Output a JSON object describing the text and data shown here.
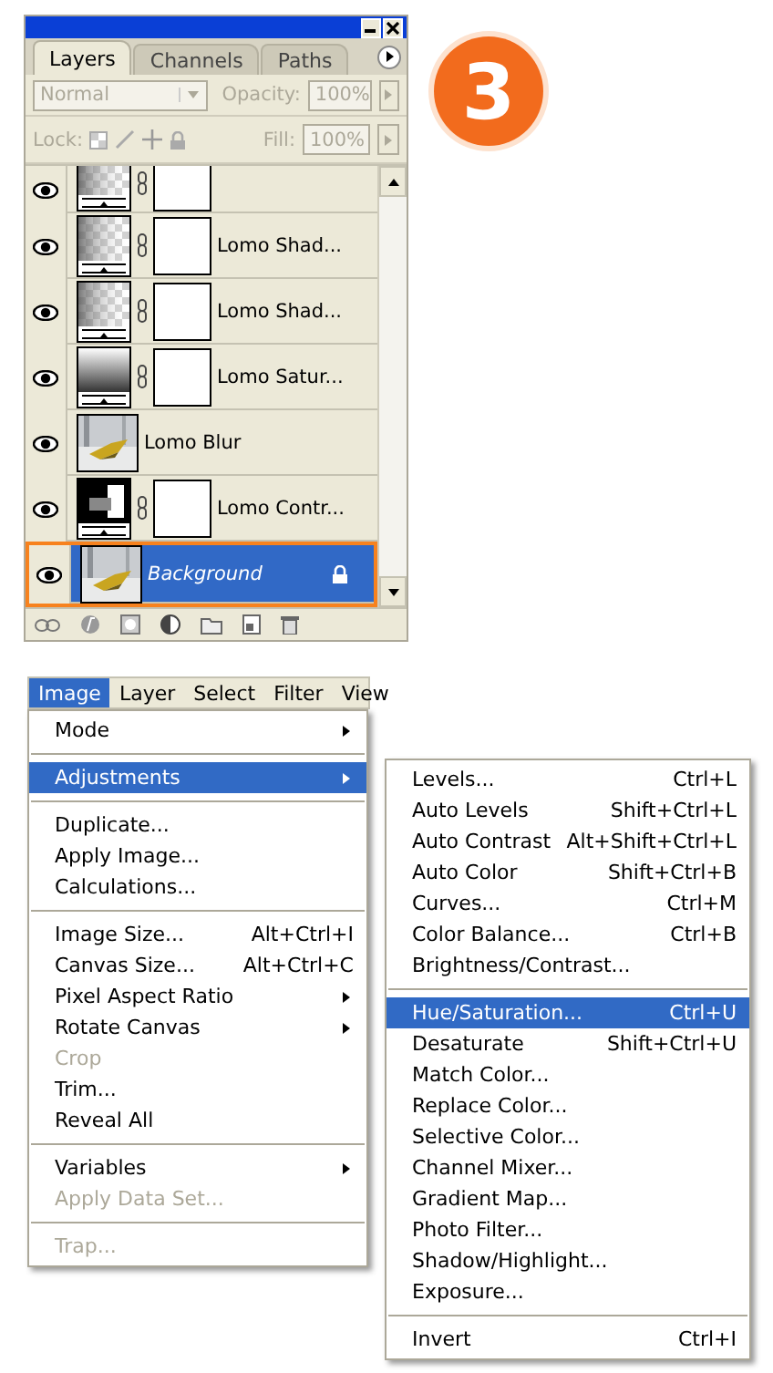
{
  "panel": {
    "tabs": [
      {
        "label": "Layers",
        "selected": true
      },
      {
        "label": "Channels",
        "selected": false
      },
      {
        "label": "Paths",
        "selected": false
      }
    ],
    "blend_mode": {
      "value": "Normal",
      "disabled": true
    },
    "opacity": {
      "label": "Opacity:",
      "value": "100%",
      "disabled": true
    },
    "lock_label": "Lock:",
    "fill": {
      "label": "Fill:",
      "value": "100%",
      "disabled": true
    },
    "layers": [
      {
        "cut": true,
        "kind": "checker",
        "mask": true,
        "visible": true,
        "selected": false,
        "locked": false
      },
      {
        "cut": false,
        "name": "Lomo Shad...",
        "kind": "checker",
        "mask": true,
        "visible": true,
        "selected": false,
        "locked": false
      },
      {
        "cut": false,
        "name": "Lomo Shad...",
        "kind": "checker",
        "mask": true,
        "visible": true,
        "selected": false,
        "locked": false
      },
      {
        "cut": false,
        "name": "Lomo Satur...",
        "kind": "gradient",
        "mask": true,
        "visible": true,
        "selected": false,
        "locked": false
      },
      {
        "cut": false,
        "name": "Lomo Blur",
        "mask": false,
        "visible": true,
        "selected": false,
        "locked": false
      },
      {
        "cut": false,
        "name": "Lomo Contr...",
        "kind": "contrast",
        "mask": true,
        "visible": true,
        "selected": false,
        "locked": false
      },
      {
        "cut": false,
        "name": "Background",
        "mask": false,
        "visible": true,
        "selected": true,
        "locked": true
      }
    ]
  },
  "step_badge": "3",
  "menubar": [
    {
      "label": "Image",
      "selected": true
    },
    {
      "label": "Layer",
      "selected": false
    },
    {
      "label": "Select",
      "selected": false
    },
    {
      "label": "Filter",
      "selected": false
    },
    {
      "label": "View",
      "selected": false
    }
  ],
  "menu": {
    "items": [
      {
        "kind": "item",
        "label": "Mode",
        "submenu": true,
        "disabled": false,
        "selected": false
      },
      {
        "kind": "separator"
      },
      {
        "kind": "item",
        "label": "Adjustments",
        "submenu": true,
        "disabled": false,
        "selected": true
      },
      {
        "kind": "separator"
      },
      {
        "kind": "item",
        "label": "Duplicate...",
        "submenu": false,
        "disabled": false,
        "selected": false
      },
      {
        "kind": "item",
        "label": "Apply Image...",
        "submenu": false,
        "disabled": false,
        "selected": false
      },
      {
        "kind": "item",
        "label": "Calculations...",
        "submenu": false,
        "disabled": false,
        "selected": false
      },
      {
        "kind": "separator"
      },
      {
        "kind": "item",
        "label": "Image Size...",
        "shortcut": "Alt+Ctrl+I",
        "submenu": false,
        "disabled": false,
        "selected": false
      },
      {
        "kind": "item",
        "label": "Canvas Size...",
        "shortcut": "Alt+Ctrl+C",
        "submenu": false,
        "disabled": false,
        "selected": false
      },
      {
        "kind": "item",
        "label": "Pixel Aspect Ratio",
        "submenu": true,
        "disabled": false,
        "selected": false
      },
      {
        "kind": "item",
        "label": "Rotate Canvas",
        "submenu": true,
        "disabled": false,
        "selected": false
      },
      {
        "kind": "item",
        "label": "Crop",
        "submenu": false,
        "disabled": true,
        "selected": false
      },
      {
        "kind": "item",
        "label": "Trim...",
        "submenu": false,
        "disabled": false,
        "selected": false
      },
      {
        "kind": "item",
        "label": "Reveal All",
        "submenu": false,
        "disabled": false,
        "selected": false
      },
      {
        "kind": "separator"
      },
      {
        "kind": "item",
        "label": "Variables",
        "submenu": true,
        "disabled": false,
        "selected": false
      },
      {
        "kind": "item",
        "label": "Apply Data Set...",
        "submenu": false,
        "disabled": true,
        "selected": false
      },
      {
        "kind": "separator"
      },
      {
        "kind": "item",
        "label": "Trap...",
        "submenu": false,
        "disabled": true,
        "selected": false
      }
    ]
  },
  "submenu": {
    "items": [
      {
        "kind": "item",
        "label": "Levels...",
        "shortcut": "Ctrl+L",
        "submenu": false,
        "disabled": false,
        "selected": false
      },
      {
        "kind": "item",
        "label": "Auto Levels",
        "shortcut": "Shift+Ctrl+L",
        "submenu": false,
        "disabled": false,
        "selected": false
      },
      {
        "kind": "item",
        "label": "Auto Contrast",
        "shortcut": "Alt+Shift+Ctrl+L",
        "submenu": false,
        "disabled": false,
        "selected": false
      },
      {
        "kind": "item",
        "label": "Auto Color",
        "shortcut": "Shift+Ctrl+B",
        "submenu": false,
        "disabled": false,
        "selected": false
      },
      {
        "kind": "item",
        "label": "Curves...",
        "shortcut": "Ctrl+M",
        "submenu": false,
        "disabled": false,
        "selected": false
      },
      {
        "kind": "item",
        "label": "Color Balance...",
        "shortcut": "Ctrl+B",
        "submenu": false,
        "disabled": false,
        "selected": false
      },
      {
        "kind": "item",
        "label": "Brightness/Contrast...",
        "submenu": false,
        "disabled": false,
        "selected": false
      },
      {
        "kind": "separator"
      },
      {
        "kind": "item",
        "label": "Hue/Saturation...",
        "shortcut": "Ctrl+U",
        "submenu": false,
        "disabled": false,
        "selected": true
      },
      {
        "kind": "item",
        "label": "Desaturate",
        "shortcut": "Shift+Ctrl+U",
        "submenu": false,
        "disabled": false,
        "selected": false
      },
      {
        "kind": "item",
        "label": "Match Color...",
        "submenu": false,
        "disabled": false,
        "selected": false
      },
      {
        "kind": "item",
        "label": "Replace Color...",
        "submenu": false,
        "disabled": false,
        "selected": false
      },
      {
        "kind": "item",
        "label": "Selective Color...",
        "submenu": false,
        "disabled": false,
        "selected": false
      },
      {
        "kind": "item",
        "label": "Channel Mixer...",
        "submenu": false,
        "disabled": false,
        "selected": false
      },
      {
        "kind": "item",
        "label": "Gradient Map...",
        "submenu": false,
        "disabled": false,
        "selected": false
      },
      {
        "kind": "item",
        "label": "Photo Filter...",
        "submenu": false,
        "disabled": false,
        "selected": false
      },
      {
        "kind": "item",
        "label": "Shadow/Highlight...",
        "submenu": false,
        "disabled": false,
        "selected": false
      },
      {
        "kind": "item",
        "label": "Exposure...",
        "submenu": false,
        "disabled": false,
        "selected": false
      },
      {
        "kind": "separator"
      },
      {
        "kind": "item",
        "label": "Invert",
        "shortcut": "Ctrl+I",
        "submenu": false,
        "disabled": false,
        "selected": false
      }
    ]
  }
}
